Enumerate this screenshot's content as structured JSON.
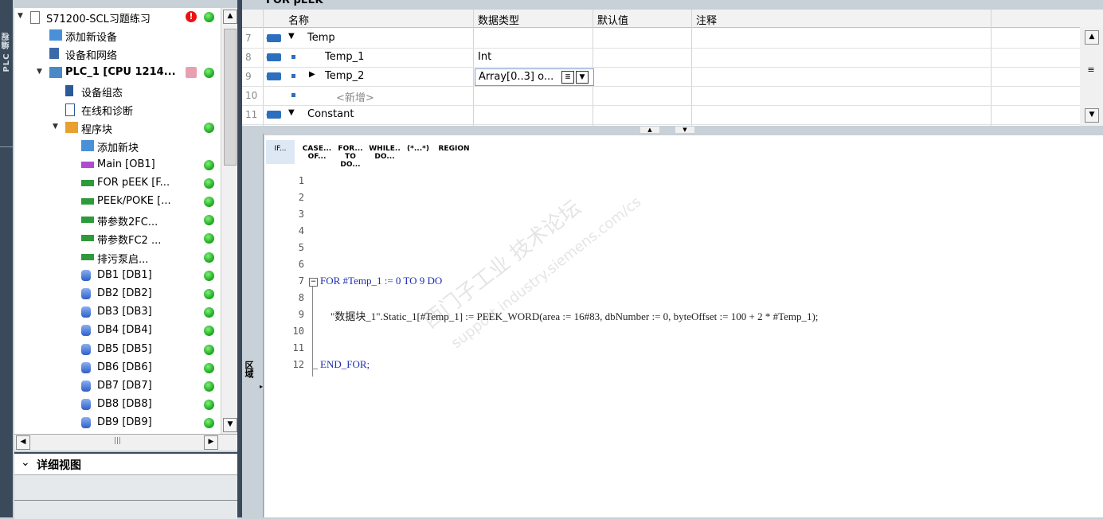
{
  "left_strip": {
    "label": "PLC 编程"
  },
  "tree": {
    "items": [
      {
        "label": "S71200-SCL习题练习",
        "indent": 0,
        "twisty": "▼",
        "status": "ok",
        "error": true
      },
      {
        "label": "添加新设备",
        "indent": 1,
        "twisty": ""
      },
      {
        "label": "设备和网络",
        "indent": 1,
        "twisty": ""
      },
      {
        "label": "PLC_1 [CPU 1214...",
        "indent": 1,
        "twisty": "▼",
        "status": "ok",
        "bold": true
      },
      {
        "label": "设备组态",
        "indent": 2,
        "twisty": ""
      },
      {
        "label": "在线和诊断",
        "indent": 2,
        "twisty": ""
      },
      {
        "label": "程序块",
        "indent": 2,
        "twisty": "▼",
        "status": "ok"
      },
      {
        "label": "添加新块",
        "indent": 3,
        "twisty": ""
      },
      {
        "label": "Main [OB1]",
        "indent": 3,
        "twisty": "",
        "status": "ok"
      },
      {
        "label": "FOR pEEK [F...",
        "indent": 3,
        "twisty": "",
        "status": "ok"
      },
      {
        "label": "PEEk/POKE [...",
        "indent": 3,
        "twisty": "",
        "status": "ok"
      },
      {
        "label": "带参数2FC...",
        "indent": 3,
        "twisty": "",
        "status": "ok"
      },
      {
        "label": "带参数FC2 ...",
        "indent": 3,
        "twisty": "",
        "status": "ok"
      },
      {
        "label": "排污泵启...",
        "indent": 3,
        "twisty": "",
        "status": "ok"
      },
      {
        "label": "DB1 [DB1]",
        "indent": 3,
        "twisty": "",
        "status": "ok"
      },
      {
        "label": "DB2 [DB2]",
        "indent": 3,
        "twisty": "",
        "status": "ok"
      },
      {
        "label": "DB3 [DB3]",
        "indent": 3,
        "twisty": "",
        "status": "ok"
      },
      {
        "label": "DB4 [DB4]",
        "indent": 3,
        "twisty": "",
        "status": "ok"
      },
      {
        "label": "DB5 [DB5]",
        "indent": 3,
        "twisty": "",
        "status": "ok"
      },
      {
        "label": "DB6 [DB6]",
        "indent": 3,
        "twisty": "",
        "status": "ok"
      },
      {
        "label": "DB7 [DB7]",
        "indent": 3,
        "twisty": "",
        "status": "ok"
      },
      {
        "label": "DB8 [DB8]",
        "indent": 3,
        "twisty": "",
        "status": "ok"
      },
      {
        "label": "DB9 [DB9]",
        "indent": 3,
        "twisty": "",
        "status": "ok"
      }
    ]
  },
  "details": {
    "title": "详细视图"
  },
  "interface": {
    "block_title": "FOR pEEK",
    "headers": {
      "name": "名称",
      "datatype": "数据类型",
      "default": "默认值",
      "comment": "注释"
    },
    "rows": [
      {
        "num": "7",
        "name": "Temp",
        "type": "",
        "section": true
      },
      {
        "num": "8",
        "name": "Temp_1",
        "type": "Int"
      },
      {
        "num": "9",
        "name": "Temp_2",
        "type": "Array[0..3] o...",
        "expand": true,
        "editing": true
      },
      {
        "num": "10",
        "name": "<新增>",
        "type": "",
        "placeholder": true
      },
      {
        "num": "11",
        "name": "Constant",
        "type": "",
        "section": true
      }
    ]
  },
  "editor_side": {
    "label": "区域"
  },
  "toolbar": [
    {
      "label": "IF...",
      "selected": true
    },
    {
      "label": "CASE... OF..."
    },
    {
      "label": "FOR... TO DO..."
    },
    {
      "label": "WHILE.. DO..."
    },
    {
      "label": "(*...*)"
    },
    {
      "label": "REGION"
    }
  ],
  "code": {
    "lines": [
      {
        "num": "1",
        "text": ""
      },
      {
        "num": "2",
        "text": ""
      },
      {
        "num": "3",
        "text": ""
      },
      {
        "num": "4",
        "text": ""
      },
      {
        "num": "5",
        "text": ""
      },
      {
        "num": "6",
        "text": ""
      },
      {
        "num": "7",
        "text": "FOR #Temp_1 := 0 TO 9 DO"
      },
      {
        "num": "8",
        "text": ""
      },
      {
        "num": "9",
        "text": "    \"数据块_1\".Static_1[#Temp_1] := PEEK_WORD(area := 16#83, dbNumber := 0, byteOffset := 100 + 2 * #Temp_1);"
      },
      {
        "num": "10",
        "text": ""
      },
      {
        "num": "11",
        "text": ""
      },
      {
        "num": "12",
        "text": "END_FOR;"
      }
    ]
  },
  "watermark": {
    "line1": "西门子工业 技术论坛",
    "line2": "support.industry.siemens.com/cs"
  }
}
